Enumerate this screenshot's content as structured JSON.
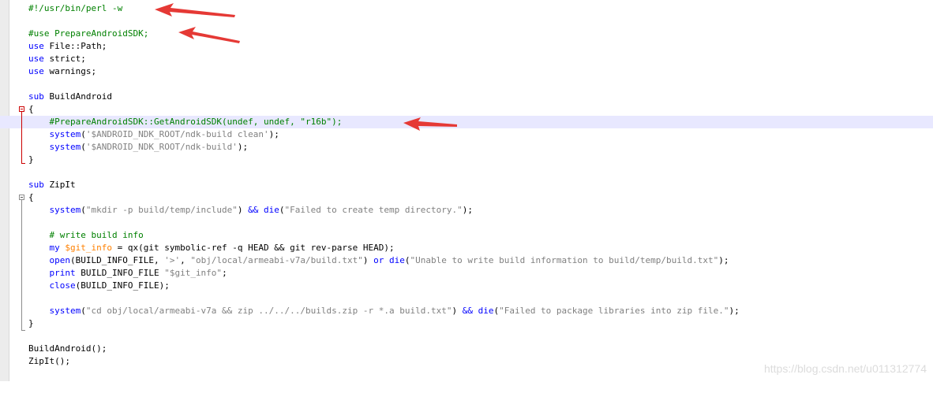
{
  "editor": {
    "lines": {
      "l1": "#!/usr/bin/perl -w",
      "l3": "#use PrepareAndroidSDK;",
      "l4_kw": "use",
      "l4_rest": " File::Path;",
      "l5_kw": "use",
      "l5_rest": " strict;",
      "l6_kw": "use",
      "l6_rest": " warnings;",
      "l8_kw": "sub",
      "l8_rest": " BuildAndroid",
      "l9": "{",
      "l10": "    #PrepareAndroidSDK::GetAndroidSDK(undef, undef, \"r16b\");",
      "l11_kw": "    system",
      "l11_p1": "(",
      "l11_str": "'$ANDROID_NDK_ROOT/ndk-build clean'",
      "l11_p2": ");",
      "l12_kw": "    system",
      "l12_p1": "(",
      "l12_str": "'$ANDROID_NDK_ROOT/ndk-build'",
      "l12_p2": ");",
      "l13": "}",
      "l15_kw": "sub",
      "l15_rest": " ZipIt",
      "l16": "{",
      "l17_kw": "    system",
      "l17_p1": "(",
      "l17_str": "\"mkdir -p build/temp/include\"",
      "l17_p2": ") ",
      "l17_op": "&&",
      "l17_sp": " ",
      "l17_kw2": "die",
      "l17_p3": "(",
      "l17_str2": "\"Failed to create temp directory.\"",
      "l17_p4": ");",
      "l19": "    # write build info",
      "l20_kw": "    my",
      "l20_sp": " ",
      "l20_var": "$git_info",
      "l20_rest": " = qx(git symbolic-ref -q HEAD && git rev-parse HEAD);",
      "l21_kw": "    open",
      "l21_p1": "(BUILD_INFO_FILE, ",
      "l21_str": "'>'",
      "l21_p2": ", ",
      "l21_str2": "\"obj/local/armeabi-v7a/build.txt\"",
      "l21_p3": ") ",
      "l21_kw2": "or",
      "l21_sp": " ",
      "l21_kw3": "die",
      "l21_p4": "(",
      "l21_str3": "\"Unable to write build information to build/temp/build.txt\"",
      "l21_p5": ");",
      "l22_kw": "    print",
      "l22_p1": " BUILD_INFO_FILE ",
      "l22_str": "\"$git_info\"",
      "l22_p2": ";",
      "l23_kw": "    close",
      "l23_p1": "(BUILD_INFO_FILE);",
      "l25_kw": "    system",
      "l25_p1": "(",
      "l25_str": "\"cd obj/local/armeabi-v7a && zip ../../../builds.zip -r *.a build.txt\"",
      "l25_p2": ") ",
      "l25_op": "&&",
      "l25_sp": " ",
      "l25_kw2": "die",
      "l25_p3": "(",
      "l25_str2": "\"Failed to package libraries into zip file.\"",
      "l25_p4": ");",
      "l26": "}",
      "l28": "BuildAndroid();",
      "l29": "ZipIt();"
    }
  },
  "watermark": "https://blog.csdn.net/u011312774",
  "colors": {
    "keyword": "#0000ff",
    "string": "#808080",
    "comment": "#008000",
    "variable": "#ff8000",
    "current_line": "#e8e8ff",
    "annotation_arrow": "#e53935"
  },
  "icons": [
    "fold-minus-icon",
    "red-arrow-annotation"
  ]
}
